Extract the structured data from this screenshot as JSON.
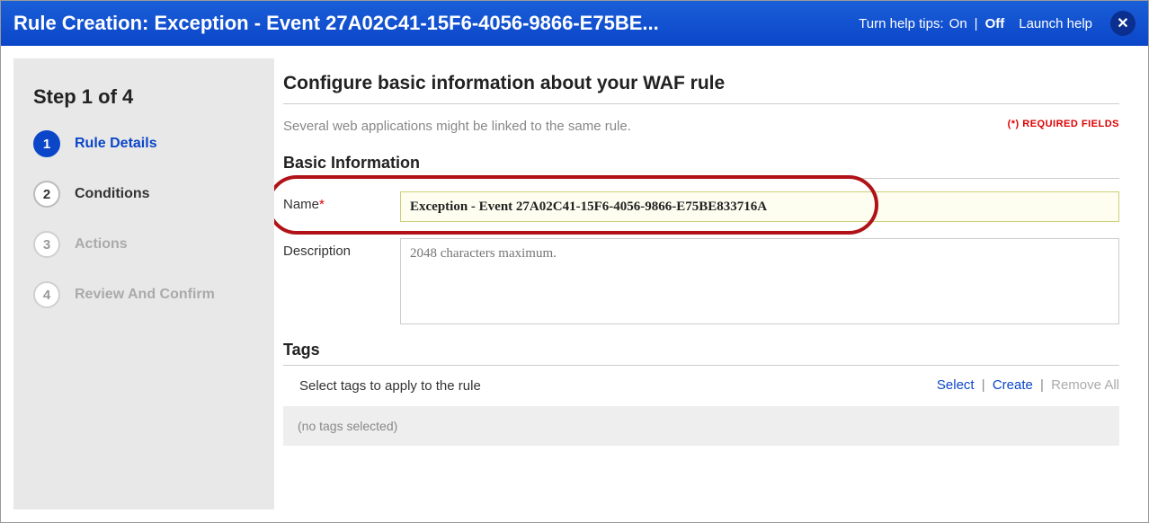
{
  "header": {
    "title": "Rule Creation: Exception - Event 27A02C41-15F6-4056-9866-E75BE...",
    "help_label": "Turn help tips:",
    "on": "On",
    "off": "Off",
    "launch_help": "Launch help"
  },
  "sidebar": {
    "step_head": "Step 1 of 4",
    "steps": [
      {
        "num": "1",
        "label": "Rule Details"
      },
      {
        "num": "2",
        "label": "Conditions"
      },
      {
        "num": "3",
        "label": "Actions"
      },
      {
        "num": "4",
        "label": "Review And Confirm"
      }
    ]
  },
  "main": {
    "title": "Configure basic information about your WAF rule",
    "required_note": "(*) REQUIRED FIELDS",
    "subtext": "Several web applications might be linked to the same rule.",
    "basic_info": "Basic Information",
    "name_label": "Name",
    "name_value": "Exception - Event 27A02C41-15F6-4056-9866-E75BE833716A",
    "desc_label": "Description",
    "desc_placeholder": "2048 characters maximum.",
    "tags_head": "Tags",
    "tags_help": "Select tags to apply to the rule",
    "tags_select": "Select",
    "tags_create": "Create",
    "tags_remove": "Remove All",
    "tags_none": "(no tags selected)"
  }
}
